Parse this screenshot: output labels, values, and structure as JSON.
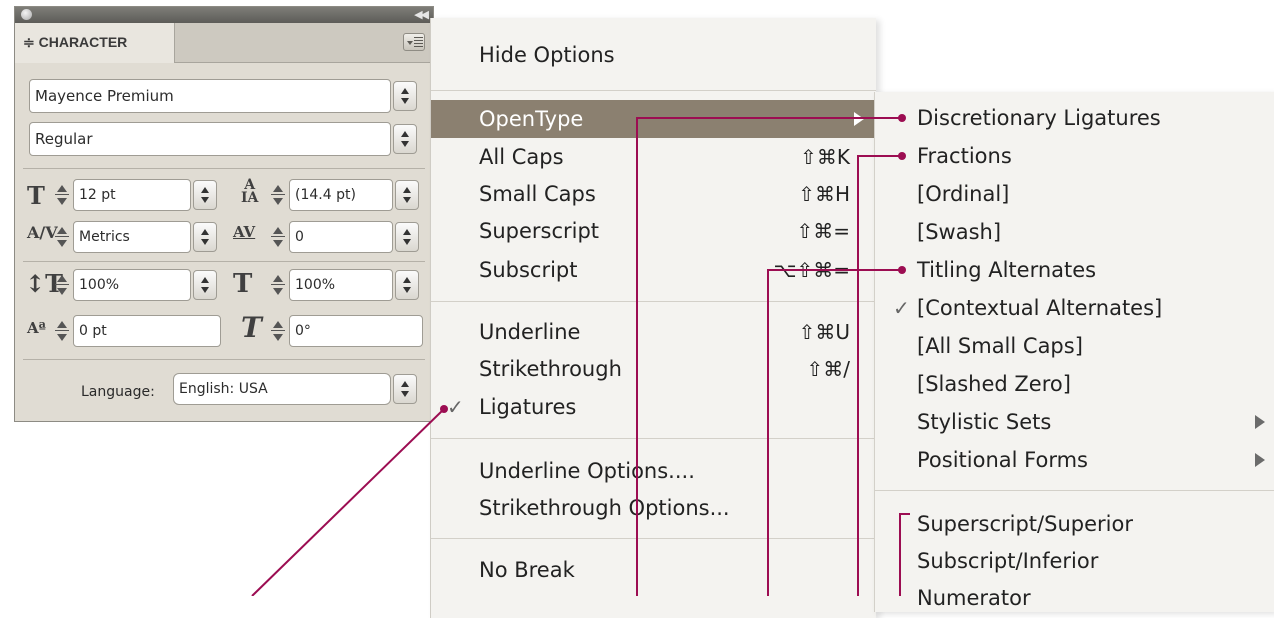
{
  "panel": {
    "tab_label": "≑ CHARACTER",
    "font_family": "Mayence Premium",
    "font_style": "Regular",
    "font_size": "12 pt",
    "leading": "(14.4 pt)",
    "kerning": "Metrics",
    "tracking": "0",
    "vertical_scale": "100%",
    "horizontal_scale": "100%",
    "baseline_shift": "0 pt",
    "skew": "0°",
    "language_label": "Language:",
    "language_value": "English: USA"
  },
  "menu": {
    "items": [
      {
        "label": "Hide Options",
        "shortcut": ""
      },
      {
        "label": "OpenType",
        "shortcut": ""
      },
      {
        "label": "All Caps",
        "shortcut": "⇧⌘K"
      },
      {
        "label": "Small Caps",
        "shortcut": "⇧⌘H"
      },
      {
        "label": "Superscript",
        "shortcut": "⇧⌘="
      },
      {
        "label": "Subscript",
        "shortcut": "⌥⇧⌘="
      },
      {
        "label": "Underline",
        "shortcut": "⇧⌘U"
      },
      {
        "label": "Strikethrough",
        "shortcut": "⇧⌘/"
      },
      {
        "label": "Ligatures",
        "shortcut": "",
        "checked": true
      },
      {
        "label": "Underline Options....",
        "shortcut": ""
      },
      {
        "label": "Strikethrough Options...",
        "shortcut": ""
      },
      {
        "label": "No Break",
        "shortcut": ""
      }
    ],
    "highlight_color": "#8b8070"
  },
  "submenu": {
    "items": [
      {
        "label": "Discretionary Ligatures"
      },
      {
        "label": "Fractions"
      },
      {
        "label": "[Ordinal]"
      },
      {
        "label": "[Swash]"
      },
      {
        "label": "Titling Alternates"
      },
      {
        "label": "[Contextual Alternates]",
        "checked": true
      },
      {
        "label": "[All Small Caps]"
      },
      {
        "label": "[Slashed Zero]"
      },
      {
        "label": "Stylistic Sets",
        "submenu": true
      },
      {
        "label": "Positional Forms",
        "submenu": true
      },
      {
        "label": "Superscript/Superior"
      },
      {
        "label": "Subscript/Inferior"
      },
      {
        "label": "Numerator"
      }
    ]
  },
  "annotation_color": "#9c0d52"
}
